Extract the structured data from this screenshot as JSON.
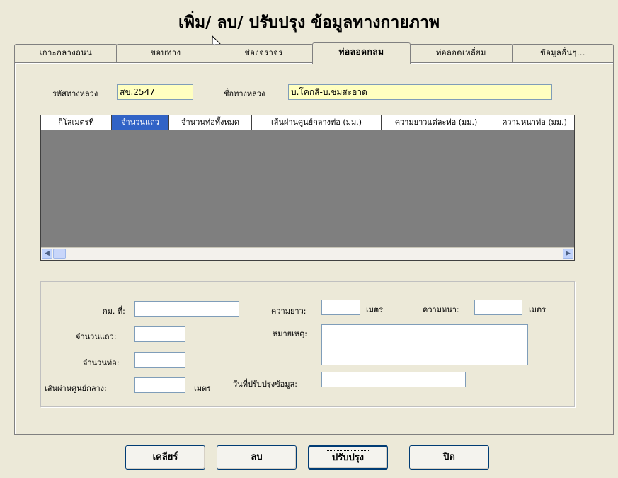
{
  "title": "เพิ่ม/ ลบ/ ปรับปรุง ข้อมูลทางกายภาพ",
  "tabs": [
    {
      "label": "เกาะกลางถนน"
    },
    {
      "label": "ขอบทาง"
    },
    {
      "label": "ช่องจราจร"
    },
    {
      "label": "ท่อลอดกลม",
      "active": true
    },
    {
      "label": "ท่อลอดเหลี่ยม"
    },
    {
      "label": "ข้อมูลอื่นๆ..."
    }
  ],
  "road": {
    "code_label": "รหัสทางหลวง",
    "code_value": "สข.2547",
    "name_label": "ชื่อทางหลวง",
    "name_value": "บ.โคกสี-บ.ชมสะอาด"
  },
  "grid": {
    "columns": [
      "กิโลเมตรที่",
      "จำนวนแถว",
      "จำนวนท่อทั้งหมด",
      "เส้นผ่านศูนย์กลางท่อ (มม.)",
      "ความยาวแต่ละท่อ (มม.)",
      "ความหนาท่อ (มม.)"
    ],
    "selected_column": "จำนวนแถว",
    "rows": []
  },
  "form": {
    "km_label": "กม. ที่:",
    "km_value": "",
    "rows_label": "จำนวนแถว:",
    "rows_value": "",
    "pipes_label": "จำนวนท่อ:",
    "pipes_value": "",
    "diameter_label": "เส้นผ่านศูนย์กลาง:",
    "diameter_value": "",
    "diameter_unit": "เมตร",
    "length_label": "ความยาว:",
    "length_value": "",
    "length_unit": "เมตร",
    "thickness_label": "ความหนา:",
    "thickness_value": "",
    "thickness_unit": "เมตร",
    "note_label": "หมายเหตุ:",
    "note_value": "",
    "updated_label": "วันที่ปรับปรุงข้อมูล:",
    "updated_value": ""
  },
  "buttons": {
    "clear": "เคลียร์",
    "delete": "ลบ",
    "update": "ปรับปรุง",
    "close": "ปิด"
  },
  "icons": {
    "scroll_left": "arrow-left-icon",
    "scroll_right": "arrow-right-icon",
    "cursor": "mouse-pointer-icon"
  },
  "colors": {
    "background": "#ece9d8",
    "highlight_field": "#ffffc0",
    "grid_body": "#7f7f7f",
    "selected_header": "#3163c6"
  }
}
